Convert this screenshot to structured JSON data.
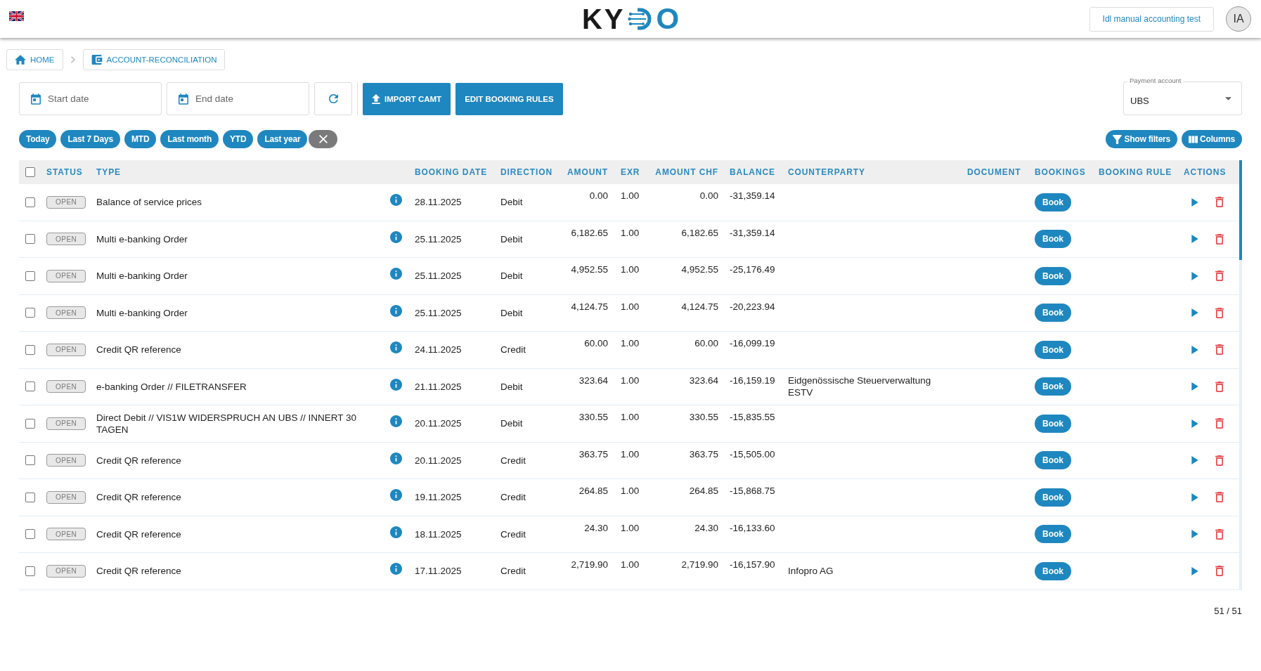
{
  "top_bar": {
    "logo": {
      "lead": "KY",
      "tail": "O"
    },
    "account_button": "Idl manual accounting test",
    "avatar": "IA"
  },
  "breadcrumbs": [
    "HOME",
    "ACCOUNT-RECONCILIATION"
  ],
  "toolbar": {
    "start_date": {
      "placeholder": "Start date"
    },
    "end_date": {
      "placeholder": "End date"
    },
    "buttons": [
      "IMPORT CAMT",
      "EDIT BOOKING RULES"
    ],
    "payment_account": {
      "label": "Payment account",
      "value": "UBS"
    }
  },
  "quick_ranges": [
    "Today",
    "Last 7 Days",
    "MTD",
    "Last month",
    "YTD",
    "Last year"
  ],
  "view_buttons": [
    "Show filters",
    "Columns"
  ],
  "table": {
    "select_all": {
      "checked": false
    },
    "columns": [
      "STATUS",
      "TYPE",
      "BOOKING DATE",
      "DIRECTION",
      "AMOUNT",
      "EXR",
      "AMOUNT CHF",
      "BALANCE",
      "COUNTERPARTY",
      "DOCUMENT",
      "BOOKINGS",
      "BOOKING RULE",
      "ACTIONS"
    ],
    "rows": [
      {
        "checked": false,
        "status": "OPEN",
        "type": "Balance of service prices",
        "booking_date": "28.11.2025",
        "direction": "Debit",
        "amount": "0.00",
        "exr": "1.00",
        "amount_chf": "0.00",
        "balance": "-31,359.14",
        "action": "Book"
      },
      {
        "checked": false,
        "status": "OPEN",
        "type": "Multi e-banking Order",
        "booking_date": "25.11.2025",
        "direction": "Debit",
        "amount": "6,182.65",
        "exr": "1.00",
        "amount_chf": "6,182.65",
        "balance": "-31,359.14",
        "action": "Book"
      },
      {
        "checked": false,
        "status": "OPEN",
        "type": "Multi e-banking Order",
        "booking_date": "25.11.2025",
        "direction": "Debit",
        "amount": "4,952.55",
        "exr": "1.00",
        "amount_chf": "4,952.55",
        "balance": "-25,176.49",
        "action": "Book"
      },
      {
        "checked": false,
        "status": "OPEN",
        "type": "Multi e-banking Order",
        "booking_date": "25.11.2025",
        "direction": "Debit",
        "amount": "4,124.75",
        "exr": "1.00",
        "amount_chf": "4,124.75",
        "balance": "-20,223.94",
        "action": "Book"
      },
      {
        "checked": false,
        "status": "OPEN",
        "type": "Credit QR reference",
        "booking_date": "24.11.2025",
        "direction": "Credit",
        "amount": "60.00",
        "exr": "1.00",
        "amount_chf": "60.00",
        "balance": "-16,099.19",
        "action": "Book"
      },
      {
        "checked": false,
        "status": "OPEN",
        "type": "e-banking Order // FILETRANSFER",
        "booking_date": "21.11.2025",
        "direction": "Debit",
        "amount": "323.64",
        "exr": "1.00",
        "amount_chf": "323.64",
        "balance": "-16,159.19",
        "counterparty": "Eidgenössische Steuerverwaltung ESTV",
        "action": "Book"
      },
      {
        "checked": false,
        "status": "OPEN",
        "type": "Direct Debit // VIS1W WIDERSPRUCH AN UBS // INNERT 30 TAGEN",
        "booking_date": "20.11.2025",
        "direction": "Debit",
        "amount": "330.55",
        "exr": "1.00",
        "amount_chf": "330.55",
        "balance": "-15,835.55",
        "action": "Book"
      },
      {
        "checked": false,
        "status": "OPEN",
        "type": "Credit QR reference",
        "booking_date": "20.11.2025",
        "direction": "Credit",
        "amount": "363.75",
        "exr": "1.00",
        "amount_chf": "363.75",
        "balance": "-15,505.00",
        "action": "Book"
      },
      {
        "checked": false,
        "status": "OPEN",
        "type": "Credit QR reference",
        "booking_date": "19.11.2025",
        "direction": "Credit",
        "amount": "264.85",
        "exr": "1.00",
        "amount_chf": "264.85",
        "balance": "-15,868.75",
        "action": "Book"
      },
      {
        "checked": false,
        "status": "OPEN",
        "type": "Credit QR reference",
        "booking_date": "18.11.2025",
        "direction": "Credit",
        "amount": "24.30",
        "exr": "1.00",
        "amount_chf": "24.30",
        "balance": "-16,133.60",
        "action": "Book"
      },
      {
        "checked": false,
        "status": "OPEN",
        "type": "Credit QR reference",
        "booking_date": "17.11.2025",
        "direction": "Credit",
        "amount": "2,719.90",
        "exr": "1.00",
        "amount_chf": "2,719.90",
        "balance": "-16,157.90",
        "counterparty": "Infopro AG",
        "action": "Book"
      }
    ]
  },
  "pagination": "51 / 51"
}
